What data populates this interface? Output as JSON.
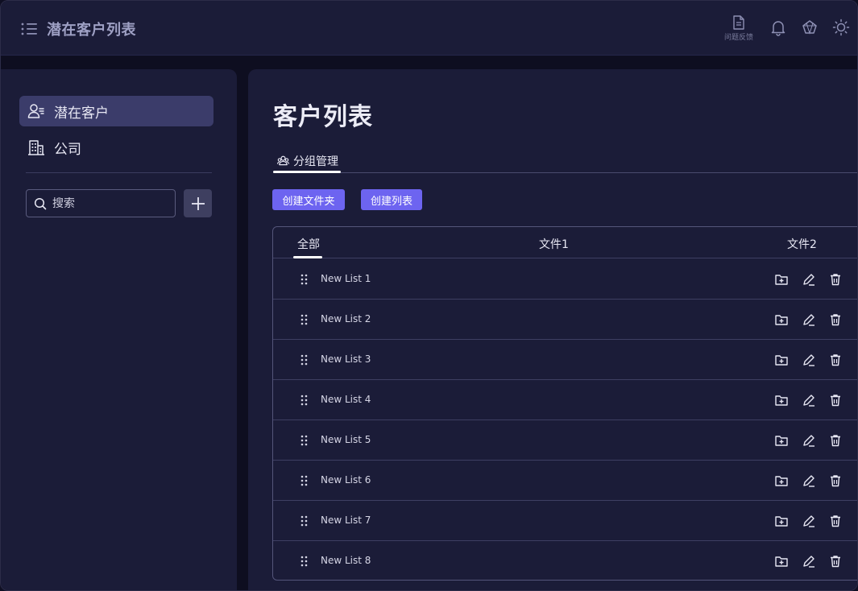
{
  "app": {
    "title": "潜在客户列表"
  },
  "header": {
    "feedback_label": "问题反馈"
  },
  "sidebar": {
    "items": [
      {
        "label": "潜在客户",
        "icon": "user-list-icon",
        "active": true
      },
      {
        "label": "公司",
        "icon": "building-icon",
        "active": false
      }
    ],
    "search": {
      "placeholder": "搜索",
      "value": ""
    }
  },
  "main": {
    "title": "客户列表",
    "tabs": [
      {
        "label": "分组管理",
        "icon": "group-icon",
        "active": true
      }
    ],
    "buttons": {
      "create_folder": "创建文件夹",
      "create_list": "创建列表"
    },
    "table": {
      "columns": [
        "全部",
        "文件1",
        "文件2"
      ],
      "active_column": "全部",
      "rows": [
        {
          "name": "New List 1"
        },
        {
          "name": "New List 2"
        },
        {
          "name": "New List 3"
        },
        {
          "name": "New List 4"
        },
        {
          "name": "New List 5"
        },
        {
          "name": "New List 6"
        },
        {
          "name": "New List 7"
        },
        {
          "name": "New List 8"
        }
      ]
    }
  },
  "colors": {
    "accent": "#6d64f0",
    "panel": "#1b1c38",
    "active_nav": "#3b3c6a"
  }
}
